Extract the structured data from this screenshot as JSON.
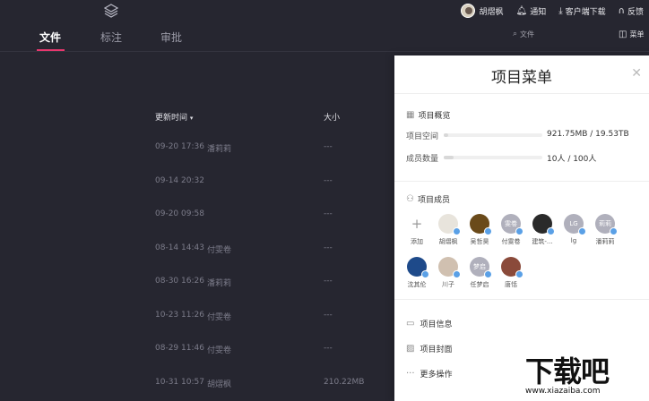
{
  "topbar": {
    "user_name": "胡熠枫",
    "notify": "通知",
    "client_download": "客户端下载",
    "feedback": "反馈"
  },
  "nav": {
    "tabs": [
      {
        "label": "文件",
        "active": true
      },
      {
        "label": "标注",
        "active": false
      },
      {
        "label": "审批",
        "active": false
      }
    ],
    "search_placeholder": "文件",
    "menu_label": "菜单"
  },
  "table": {
    "col_updated": "更新时间",
    "col_size": "大小",
    "rows": [
      {
        "time": "09-20 17:36",
        "user": "潘莉莉",
        "size": "---"
      },
      {
        "time": "09-14 20:32",
        "user": "",
        "size": "---"
      },
      {
        "time": "09-20 09:58",
        "user": "",
        "size": "---"
      },
      {
        "time": "08-14 14:43",
        "user": "付雯卷",
        "size": "---"
      },
      {
        "time": "08-30 16:26",
        "user": "潘莉莉",
        "size": "---"
      },
      {
        "time": "10-23 11:26",
        "user": "付雯卷",
        "size": "---"
      },
      {
        "time": "08-29 11:46",
        "user": "付雯卷",
        "size": "---"
      },
      {
        "time": "10-31 10:57",
        "user": "胡熠枫",
        "size": "210.22MB"
      }
    ]
  },
  "panel": {
    "title": "项目菜单",
    "overview": {
      "title": "项目概览",
      "space_label": "项目空间",
      "space_value": "921.75MB / 19.53TB",
      "space_fraction": 0.046,
      "members_label": "成员数量",
      "members_value": "10人 / 100人",
      "members_fraction": 0.1
    },
    "members": {
      "title": "项目成员",
      "add_label": "添加",
      "list": [
        {
          "name": "胡熠枫",
          "initials": "",
          "color": "#e8e4dc"
        },
        {
          "name": "吴哲昊",
          "initials": "",
          "color": "#6a4a1a"
        },
        {
          "name": "付雯卷",
          "initials": "雯卷",
          "color": "#b0b0bc"
        },
        {
          "name": "建筑-...",
          "initials": "",
          "color": "#2a2a2a"
        },
        {
          "name": "lg",
          "initials": "LG",
          "color": "#b0b0bc"
        },
        {
          "name": "潘莉莉",
          "initials": "莉莉",
          "color": "#b0b0bc"
        },
        {
          "name": "沈其伦",
          "initials": "",
          "color": "#1e4a8a"
        },
        {
          "name": "川子",
          "initials": "",
          "color": "#d0c0b0"
        },
        {
          "name": "任梦启",
          "initials": "梦启",
          "color": "#b0b0bc"
        },
        {
          "name": "唐恬",
          "initials": "",
          "color": "#8a4a3a"
        }
      ]
    },
    "items": {
      "info": "项目信息",
      "cover": "项目封面",
      "more": "更多操作"
    }
  },
  "watermark": {
    "text": "下载吧",
    "url": "www.xiazaiba.com"
  }
}
